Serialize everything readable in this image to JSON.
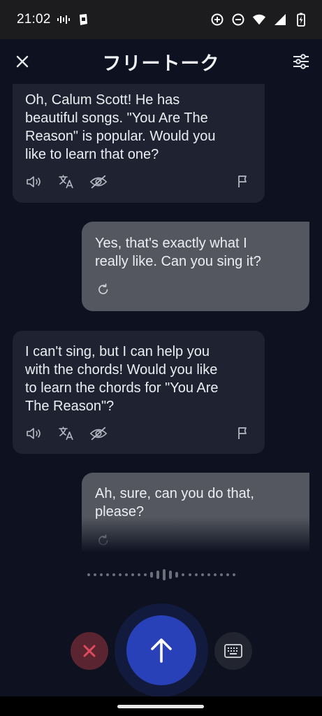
{
  "status_bar": {
    "time": "21:02",
    "icons": [
      "voicemail-icon",
      "clipboard-icon",
      "data-saver-icon",
      "do-not-disturb-icon",
      "wifi-icon",
      "signal-icon",
      "battery-charging-icon"
    ]
  },
  "header": {
    "title": "フリートーク",
    "close_icon": "close-icon",
    "settings_icon": "tune-icon"
  },
  "messages": [
    {
      "role": "ai",
      "lines": [
        "Oh, Calum Scott! He has",
        "beautiful songs. \"You Are The",
        "Reason\" is popular. Would you",
        "like to learn that one?"
      ],
      "actions": [
        "speaker-icon",
        "translate-icon",
        "hide-icon",
        "flag-icon"
      ]
    },
    {
      "role": "user",
      "lines": [
        "Yes, that's exactly what I",
        "really like. Can you sing it?"
      ],
      "actions": [
        "retry-icon"
      ]
    },
    {
      "role": "ai",
      "lines": [
        "I can't sing, but I can help you",
        "with the chords! Would you like",
        "to learn the chords for \"You Are",
        "The Reason\"?"
      ],
      "actions": [
        "speaker-icon",
        "translate-icon",
        "hide-icon",
        "flag-icon"
      ]
    },
    {
      "role": "user",
      "lines": [
        "Ah, sure, can you do that,",
        "please?"
      ],
      "actions": [
        "retry-icon"
      ]
    }
  ],
  "controls": {
    "cancel_icon": "close-icon",
    "send_icon": "arrow-up-icon",
    "keyboard_icon": "keyboard-icon"
  },
  "colors": {
    "background": "#0d1120",
    "ai_bubble": "#1f2230",
    "user_bubble": "#54575f",
    "send_button": "#2840b8",
    "cancel_button": "#5a2430"
  }
}
